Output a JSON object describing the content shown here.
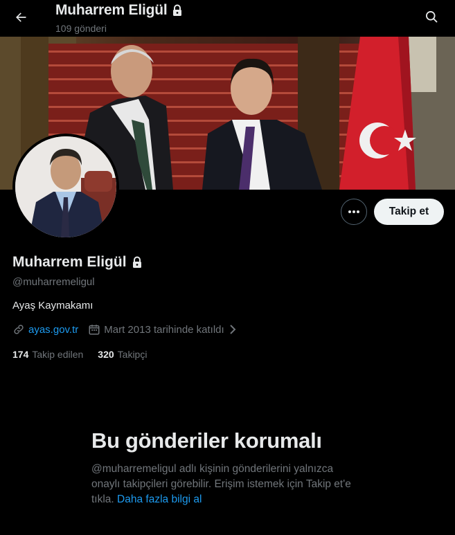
{
  "header": {
    "name": "Muharrem Eligül",
    "post_count": "109 gönderi"
  },
  "profile": {
    "display_name": "Muharrem Eligül",
    "handle": "@muharremeligul",
    "bio": "Ayaş Kaymakamı",
    "website": "ayas.gov.tr",
    "joined": "Mart 2013 tarihinde katıldı",
    "following_count": "174",
    "following_label": "Takip edilen",
    "followers_count": "320",
    "followers_label": "Takipçi"
  },
  "actions": {
    "follow_label": "Takip et"
  },
  "protected": {
    "title": "Bu gönderiler korumalı",
    "body": "@muharremeligul adlı kişinin gönderilerini yalnızca onaylı takipçileri görebilir. Erişim istemek için Takip et'e tıkla.",
    "learn_more": "Daha fazla bilgi al"
  },
  "colors": {
    "background": "#000000",
    "text_primary": "#e7e9ea",
    "text_secondary": "#71767b",
    "accent": "#1d9bf0",
    "follow_button": "#eff3f4"
  },
  "icons": {
    "back": "arrow-left-icon",
    "lock": "lock-icon",
    "search": "search-icon",
    "more": "more-dots-icon",
    "link": "link-icon",
    "calendar": "calendar-icon",
    "chevron": "chevron-right-icon"
  }
}
